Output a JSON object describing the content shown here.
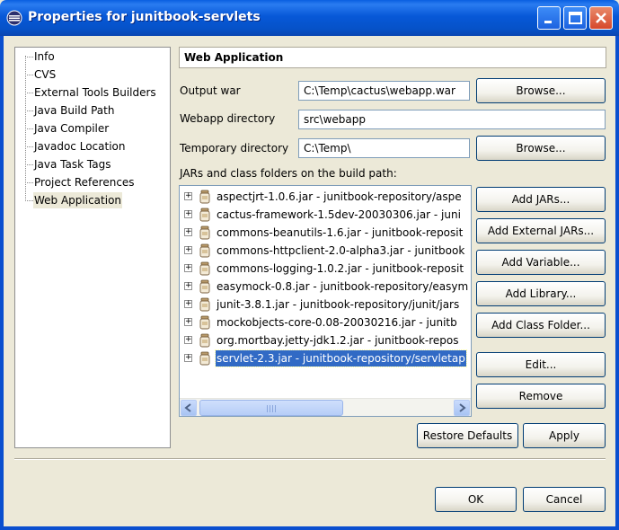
{
  "window": {
    "title": "Properties for junitbook-servlets"
  },
  "nav": {
    "items": [
      "Info",
      "CVS",
      "External Tools Builders",
      "Java Build Path",
      "Java Compiler",
      "Javadoc Location",
      "Java Task Tags",
      "Project References",
      "Web Application"
    ],
    "selected": "Web Application"
  },
  "page": {
    "header": "Web Application",
    "output_war_label": "Output war",
    "output_war_value": "C:\\Temp\\cactus\\webapp.war",
    "webapp_dir_label": "Webapp directory",
    "webapp_dir_value": "src\\webapp",
    "temp_dir_label": "Temporary directory",
    "temp_dir_value": "C:\\Temp\\",
    "browse_label": "Browse...",
    "jars_label": "JARs and class folders on the build path:",
    "jars": [
      "aspectjrt-1.0.6.jar - junitbook-repository/aspe",
      "cactus-framework-1.5dev-20030306.jar - juni",
      "commons-beanutils-1.6.jar - junitbook-reposit",
      "commons-httpclient-2.0-alpha3.jar - junitbook",
      "commons-logging-1.0.2.jar - junitbook-reposit",
      "easymock-0.8.jar - junitbook-repository/easym",
      "junit-3.8.1.jar - junitbook-repository/junit/jars",
      "mockobjects-core-0.08-20030216.jar - junitb",
      "org.mortbay.jetty-jdk1.2.jar - junitbook-repos",
      "servlet-2.3.jar - junitbook-repository/servletap"
    ],
    "selected_jar_index": 9,
    "buttons": {
      "add_jars": "Add JARs...",
      "add_external_jars": "Add External JARs...",
      "add_variable": "Add Variable...",
      "add_library": "Add Library...",
      "add_class_folder": "Add Class Folder...",
      "edit": "Edit...",
      "remove": "Remove"
    },
    "restore_defaults": "Restore Defaults",
    "apply": "Apply"
  },
  "footer": {
    "ok": "OK",
    "cancel": "Cancel"
  },
  "colors": {
    "titlebar": "#0758d8",
    "selection": "#316ac5",
    "dialog_bg": "#ece9d8"
  }
}
